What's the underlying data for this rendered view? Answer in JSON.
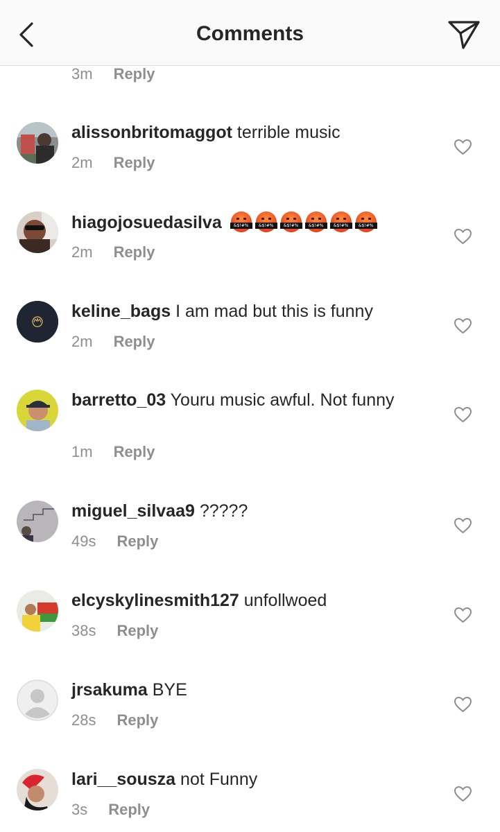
{
  "header": {
    "title": "Comments",
    "back_icon": "chevron-left-icon",
    "send_icon": "paper-plane-icon"
  },
  "top_comment_meta": {
    "time": "3m",
    "reply_label": "Reply"
  },
  "comments": [
    {
      "username": "alissonbritomaggot",
      "text": "terrible music",
      "time": "2m",
      "reply_label": "Reply",
      "avatar": "photo-man-outdoors"
    },
    {
      "username": "hiagojosuedasilva",
      "text": "",
      "emoji": "cursing-face",
      "emoji_count": 6,
      "time": "2m",
      "reply_label": "Reply",
      "avatar": "photo-man-sunglasses"
    },
    {
      "username": "keline_bags",
      "text": "I am mad but this is funny",
      "time": "2m",
      "reply_label": "Reply",
      "avatar": "crown-logo-dark"
    },
    {
      "username": "barretto_03",
      "text": "Youru music awful. Not funny",
      "time": "1m",
      "reply_label": "Reply",
      "avatar": "photo-man-cap-yellow"
    },
    {
      "username": "miguel_silvaa9",
      "text": "?????",
      "time": "49s",
      "reply_label": "Reply",
      "avatar": "photo-stairs"
    },
    {
      "username": "elcyskylinesmith127",
      "text": "unfollwoed",
      "time": "38s",
      "reply_label": "Reply",
      "avatar": "photo-person-yellow"
    },
    {
      "username": "jrsakuma",
      "text": "BYE",
      "time": "28s",
      "reply_label": "Reply",
      "avatar": "default-avatar-icon"
    },
    {
      "username": "lari__sousza",
      "text": "not Funny",
      "time": "3s",
      "reply_label": "Reply",
      "avatar": "photo-woman-red-hair"
    }
  ],
  "colors": {
    "text": "#262626",
    "meta": "#8e8e8e",
    "header_bg": "#fafafa",
    "divider": "#dbdbdb"
  }
}
